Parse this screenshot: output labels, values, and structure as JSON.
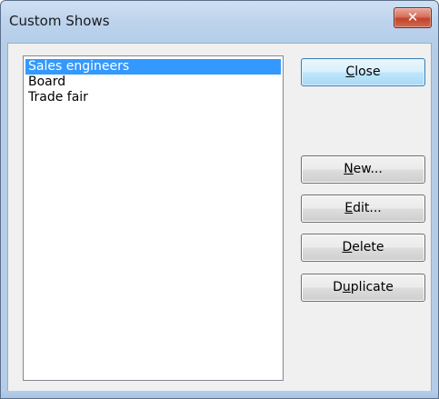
{
  "window": {
    "title": "Custom Shows",
    "close_glyph": "✕"
  },
  "shows_list": {
    "items": [
      {
        "label": "Sales engineers",
        "selected": true
      },
      {
        "label": "Board",
        "selected": false
      },
      {
        "label": "Trade fair",
        "selected": false
      }
    ]
  },
  "buttons": {
    "close": {
      "pre": "",
      "acc": "C",
      "post": "lose"
    },
    "new": {
      "pre": "",
      "acc": "N",
      "post": "ew..."
    },
    "edit": {
      "pre": "",
      "acc": "E",
      "post": "dit..."
    },
    "delete": {
      "pre": "",
      "acc": "D",
      "post": "elete"
    },
    "duplicate": {
      "pre": "D",
      "acc": "u",
      "post": "plicate"
    }
  },
  "colors": {
    "selection": "#3399ff",
    "close_button": "#c0432b"
  }
}
